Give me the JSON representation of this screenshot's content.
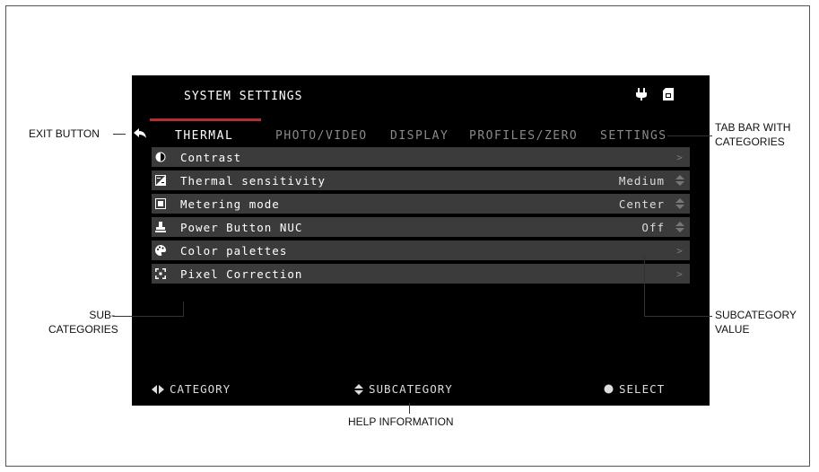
{
  "screen": {
    "title": "SYSTEM SETTINGS",
    "tabs": [
      {
        "label": "THERMAL",
        "active": true
      },
      {
        "label": "PHOTO/VIDEO",
        "active": false
      },
      {
        "label": "DISPLAY",
        "active": false
      },
      {
        "label": "PROFILES/ZERO",
        "active": false
      },
      {
        "label": "SETTINGS",
        "active": false
      }
    ],
    "items": [
      {
        "icon": "contrast-icon",
        "label": "Contrast",
        "value": "",
        "control": "arrow"
      },
      {
        "icon": "thermal-sensitivity-icon",
        "label": "Thermal sensitivity",
        "value": "Medium",
        "control": "spinner"
      },
      {
        "icon": "metering-mode-icon",
        "label": "Metering mode",
        "value": "Center",
        "control": "spinner"
      },
      {
        "icon": "power-button-icon",
        "label": "Power Button NUC",
        "value": "Off",
        "control": "spinner"
      },
      {
        "icon": "palette-icon",
        "label": "Color palettes",
        "value": "",
        "control": "arrow"
      },
      {
        "icon": "pixel-correction-icon",
        "label": "Pixel Correction",
        "value": "",
        "control": "arrow"
      }
    ],
    "footer": {
      "category": "CATEGORY",
      "subcategory": "SUBCATEGORY",
      "select": "SELECT"
    },
    "accent_color": "#b4302e"
  },
  "annotations": {
    "exit_button": "EXIT BUTTON",
    "tab_bar_line1": "TAB BAR WITH",
    "tab_bar_line2": "CATEGORIES",
    "sub_line1": "SUB-",
    "sub_line2": "CATEGORIES",
    "subvalue_line1": "SUBCATEGORY",
    "subvalue_line2": "VALUE",
    "help": "HELP INFORMATION"
  }
}
